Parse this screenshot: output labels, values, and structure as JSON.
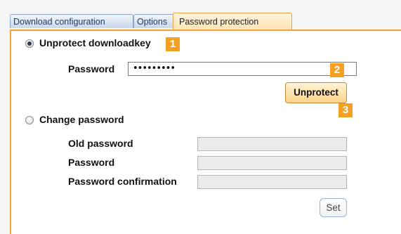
{
  "tabs": [
    {
      "label": "Download configuration"
    },
    {
      "label": "Options"
    },
    {
      "label": "Password protection"
    }
  ],
  "unprotect": {
    "radio_label": "Unprotect downloadkey",
    "password_label": "Password",
    "password_value": "•••••••••",
    "button_label": "Unprotect"
  },
  "change": {
    "radio_label": "Change password",
    "old_password_label": "Old password",
    "password_label": "Password",
    "confirmation_label": "Password confirmation",
    "button_label": "Set"
  },
  "markers": [
    "1",
    "2",
    "3"
  ],
  "colors": {
    "accent": "#f3a33b",
    "marker": "#f4a023",
    "tab_inactive_text": "#1f3a5f"
  }
}
